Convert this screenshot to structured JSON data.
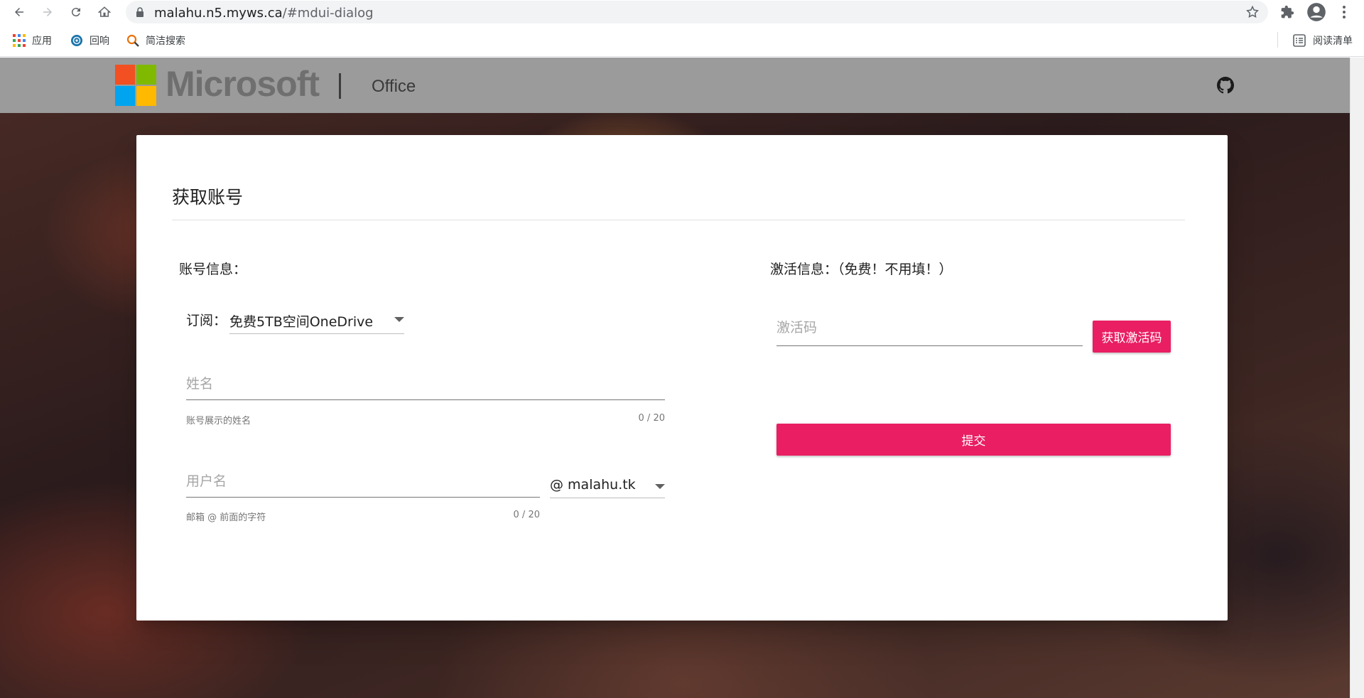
{
  "browser": {
    "url_host": "malahu.n5.myws.ca",
    "url_path": "/#mdui-dialog",
    "bookmarks": [
      {
        "label": "应用",
        "icon": "apps-grid-icon"
      },
      {
        "label": "回响",
        "icon": "echo-icon"
      },
      {
        "label": "简洁搜索",
        "icon": "search-icon"
      }
    ],
    "reading_list_label": "阅读清单"
  },
  "header": {
    "brand": "Microsoft",
    "product": "Office",
    "logo_colors": [
      "#f25022",
      "#7fba00",
      "#00a4ef",
      "#ffb900"
    ]
  },
  "dialog": {
    "title": "获取账号",
    "account_section": {
      "title": "账号信息：",
      "subscription_label": "订阅：",
      "subscription_value": "免费5TB空间OneDrive",
      "name_placeholder": "姓名",
      "name_helper": "账号展示的姓名",
      "name_counter": "0 / 20",
      "username_placeholder": "用户名",
      "username_helper": "邮箱 @ 前面的字符",
      "username_counter": "0 / 20",
      "domain_value": "@ malahu.tk"
    },
    "activation_section": {
      "title": "激活信息：（免费！不用填！）",
      "code_placeholder": "激活码",
      "get_code_button": "获取激活码",
      "submit_button": "提交"
    }
  },
  "colors": {
    "accent": "#e91e63",
    "header_bg": "#9b9b9b"
  }
}
